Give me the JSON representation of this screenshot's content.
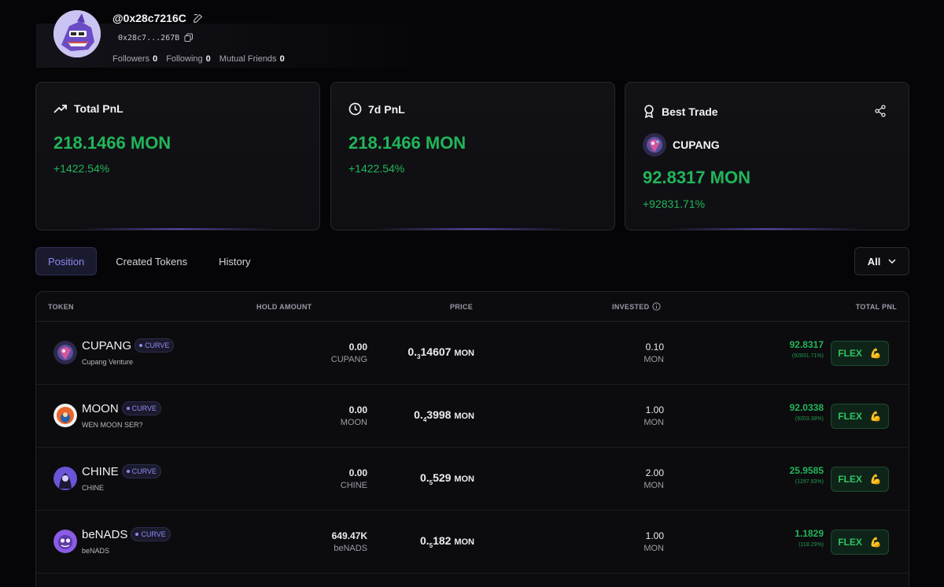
{
  "profile": {
    "handle": "@0x28c7216C",
    "address": "0x28c7...267B",
    "followers_label": "Followers",
    "followers": "0",
    "following_label": "Following",
    "following": "0",
    "mutual_label": "Mutual Friends",
    "mutual": "0"
  },
  "cards": {
    "total": {
      "title": "Total PnL",
      "value": "218.1466 MON",
      "pct": "+1422.54%"
    },
    "seven": {
      "title": "7d PnL",
      "value": "218.1466 MON",
      "pct": "+1422.54%"
    },
    "best": {
      "title": "Best Trade",
      "token": "CUPANG",
      "value": "92.8317 MON",
      "pct": "+92831.71%"
    }
  },
  "tabs": {
    "position": "Position",
    "created": "Created Tokens",
    "history": "History"
  },
  "filter": {
    "label": "All"
  },
  "table": {
    "headers": {
      "token": "TOKEN",
      "hold": "HOLD AMOUNT",
      "price": "PRICE",
      "invested": "INVESTED",
      "pnl": "TOTAL PNL"
    },
    "badge_label": "CURVE",
    "flex_label": "FLEX",
    "rows": [
      {
        "name": "CUPANG",
        "sub": "Cupang Venture",
        "hold": "0.00",
        "hold_unit": "CUPANG",
        "price_lead": "0.",
        "price_zeros": "3",
        "price_digits": "14607",
        "price_unit": "MON",
        "invested": "0.10",
        "invested_unit": "MON",
        "pnl": "92.8317",
        "pnl_pct": "(92831.71%)"
      },
      {
        "name": "MOON",
        "sub": "WEN MOON SER?",
        "hold": "0.00",
        "hold_unit": "MOON",
        "price_lead": "0.",
        "price_zeros": "4",
        "price_digits": "3998",
        "price_unit": "MON",
        "invested": "1.00",
        "invested_unit": "MON",
        "pnl": "92.0338",
        "pnl_pct": "(9203.38%)"
      },
      {
        "name": "CHINE",
        "sub": "CHINE",
        "hold": "0.00",
        "hold_unit": "CHINE",
        "price_lead": "0.",
        "price_zeros": "5",
        "price_digits": "529",
        "price_unit": "MON",
        "invested": "2.00",
        "invested_unit": "MON",
        "pnl": "25.9585",
        "pnl_pct": "(1297.93%)"
      },
      {
        "name": "beNADS",
        "sub": "beNADS",
        "hold": "649.47K",
        "hold_unit": "beNADS",
        "price_lead": "0.",
        "price_zeros": "5",
        "price_digits": "182",
        "price_unit": "MON",
        "invested": "1.00",
        "invested_unit": "MON",
        "pnl": "1.1829",
        "pnl_pct": "(118.29%)"
      }
    ]
  },
  "colors": {
    "green": "#22b55a",
    "accent": "#8b88f0",
    "bg": "#050507"
  }
}
